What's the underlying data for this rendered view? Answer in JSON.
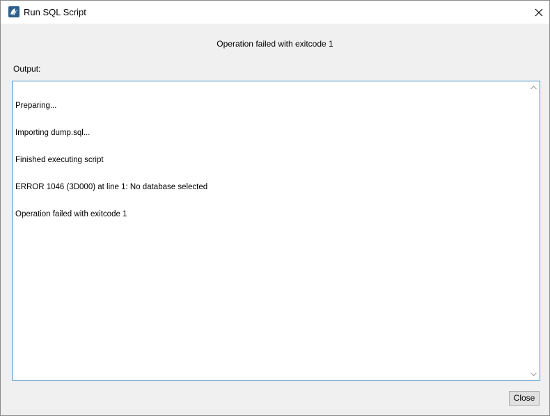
{
  "window": {
    "title": "Run SQL Script",
    "app_icon": "mysql-workbench-dolphin-icon",
    "close_icon": "close-icon"
  },
  "status_message": "Operation failed with exitcode 1",
  "output": {
    "label": "Output:",
    "lines": [
      "Preparing...",
      "Importing dump.sql...",
      "Finished executing script",
      "ERROR 1046 (3D000) at line 1: No database selected",
      "Operation failed with exitcode 1"
    ]
  },
  "buttons": {
    "close_label": "Close"
  },
  "colors": {
    "accent_border": "#3c8fc9",
    "dialog_background": "#f0f0f0"
  }
}
